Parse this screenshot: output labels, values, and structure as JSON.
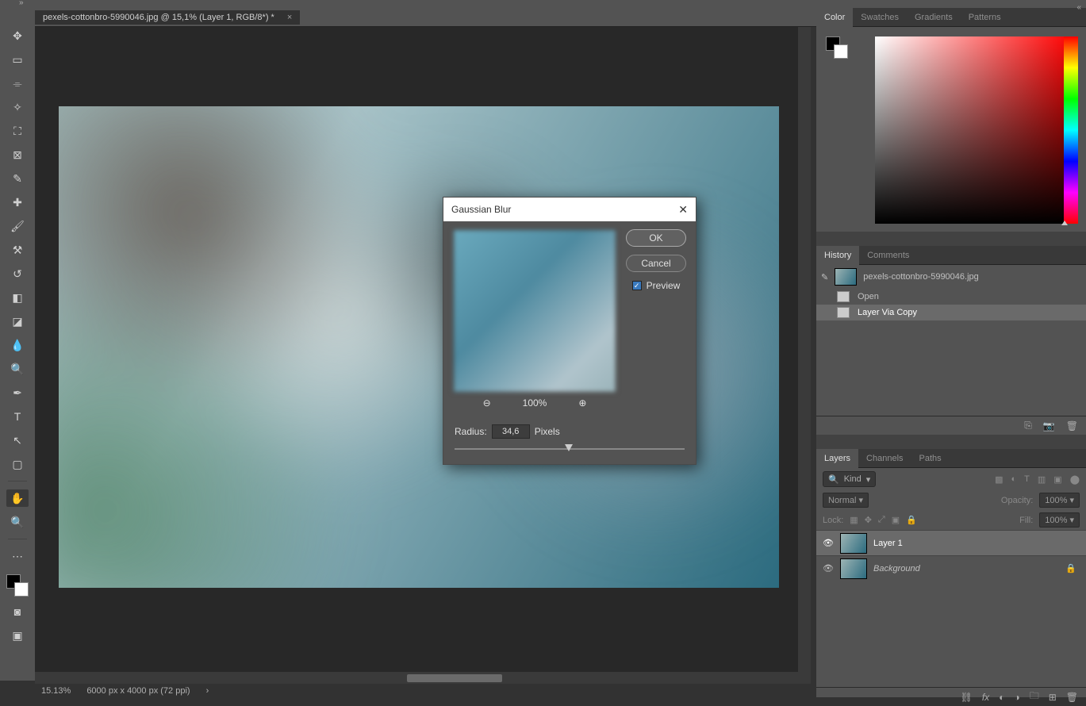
{
  "document_tab": {
    "title": "pexels-cottonbro-5990046.jpg @ 15,1% (Layer 1, RGB/8*) *"
  },
  "statusbar": {
    "zoom": "15.13%",
    "doc_info": "6000 px x 4000 px (72 ppi)"
  },
  "tools": [
    "move",
    "marquee",
    "lasso",
    "wand",
    "crop",
    "frame",
    "eyedropper",
    "heal",
    "brush",
    "stamp",
    "history-brush",
    "eraser",
    "gradient",
    "blur",
    "dodge",
    "pen",
    "type",
    "path-select",
    "rectangle",
    "hand",
    "zoom"
  ],
  "right_panels": {
    "color_tabs": [
      "Color",
      "Swatches",
      "Gradients",
      "Patterns"
    ],
    "color_active": "Color",
    "history_tabs": [
      "History",
      "Comments"
    ],
    "history_active": "History",
    "history": {
      "doc": "pexels-cottonbro-5990046.jpg",
      "items": [
        {
          "label": "Open",
          "selected": false
        },
        {
          "label": "Layer Via Copy",
          "selected": true
        }
      ]
    },
    "layers_tabs": [
      "Layers",
      "Channels",
      "Paths"
    ],
    "layers_active": "Layers",
    "layers": {
      "kind_label": "Kind",
      "blend_mode": "Normal",
      "opacity_label": "Opacity:",
      "opacity_value": "100%",
      "lock_label": "Lock:",
      "fill_label": "Fill:",
      "fill_value": "100%",
      "items": [
        {
          "name": "Layer 1",
          "selected": true,
          "locked": false,
          "italic": false
        },
        {
          "name": "Background",
          "selected": false,
          "locked": true,
          "italic": true
        }
      ]
    }
  },
  "dialog": {
    "title": "Gaussian Blur",
    "ok": "OK",
    "cancel": "Cancel",
    "preview_label": "Preview",
    "preview_checked": true,
    "zoom_value": "100%",
    "radius_label": "Radius:",
    "radius_value": "34,6",
    "radius_unit": "Pixels"
  }
}
